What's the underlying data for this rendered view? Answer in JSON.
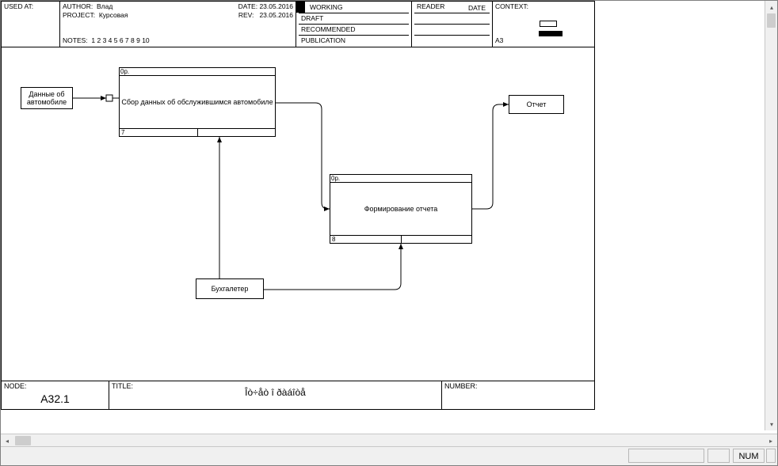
{
  "header": {
    "used_at_label": "USED AT:",
    "author_label": "AUTHOR:",
    "author": "Влад",
    "project_label": "PROJECT:",
    "project": "Курсовая",
    "notes_label": "NOTES:",
    "notes_values": "1  2  3  4  5  6  7  8  9  10",
    "date_label": "DATE:",
    "date": "23.05.2016",
    "rev_label": "REV:",
    "rev": "23.05.2016",
    "status": {
      "working": "WORKING",
      "draft": "DRAFT",
      "recommended": "RECOMMENDED",
      "publication": "PUBLICATION"
    },
    "reader_label": "READER",
    "reader_date_label": "DATE",
    "context_label": "CONTEXT:",
    "context_value": "A3"
  },
  "diagram": {
    "inputs": [
      {
        "id": "data_auto",
        "label": "Данные об\nавтомобиле"
      }
    ],
    "activities": [
      {
        "id": "act7",
        "num": "7",
        "prefix": "0р.",
        "label": "Сбор данных об обслужившимся автомобиле"
      },
      {
        "id": "act8",
        "num": "8",
        "prefix": "0р.",
        "label": "Формирование отчета"
      }
    ],
    "mechanism": {
      "id": "mech",
      "label": "Бухгалетер"
    },
    "output": {
      "id": "out",
      "label": "Отчет"
    }
  },
  "footer": {
    "node_label": "NODE:",
    "node_value": "A32.1",
    "title_label": "TITLE:",
    "title_value": "Îò÷åò î ðàáîòå",
    "number_label": "NUMBER:"
  },
  "statusbar": {
    "num_lock": "NUM"
  }
}
